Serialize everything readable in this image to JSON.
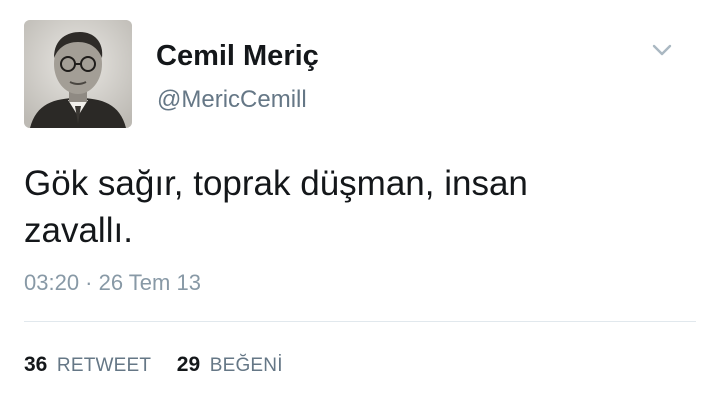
{
  "user": {
    "display_name": "Cemil Meriç",
    "handle": "@MericCemill"
  },
  "icons": {
    "menu": "chevron-down-icon"
  },
  "tweet": {
    "text": "Gök sağır, toprak düşman, insan zavallı.",
    "timestamp": "03:20 · 26 Tem 13"
  },
  "stats": {
    "retweets_count": "36",
    "retweets_label": "RETWEET",
    "likes_count": "29",
    "likes_label": "BEĞENİ"
  },
  "colors": {
    "text_primary": "#14171a",
    "text_secondary": "#657786",
    "timestamp": "#8899a6",
    "divider": "#e1e8ed"
  }
}
